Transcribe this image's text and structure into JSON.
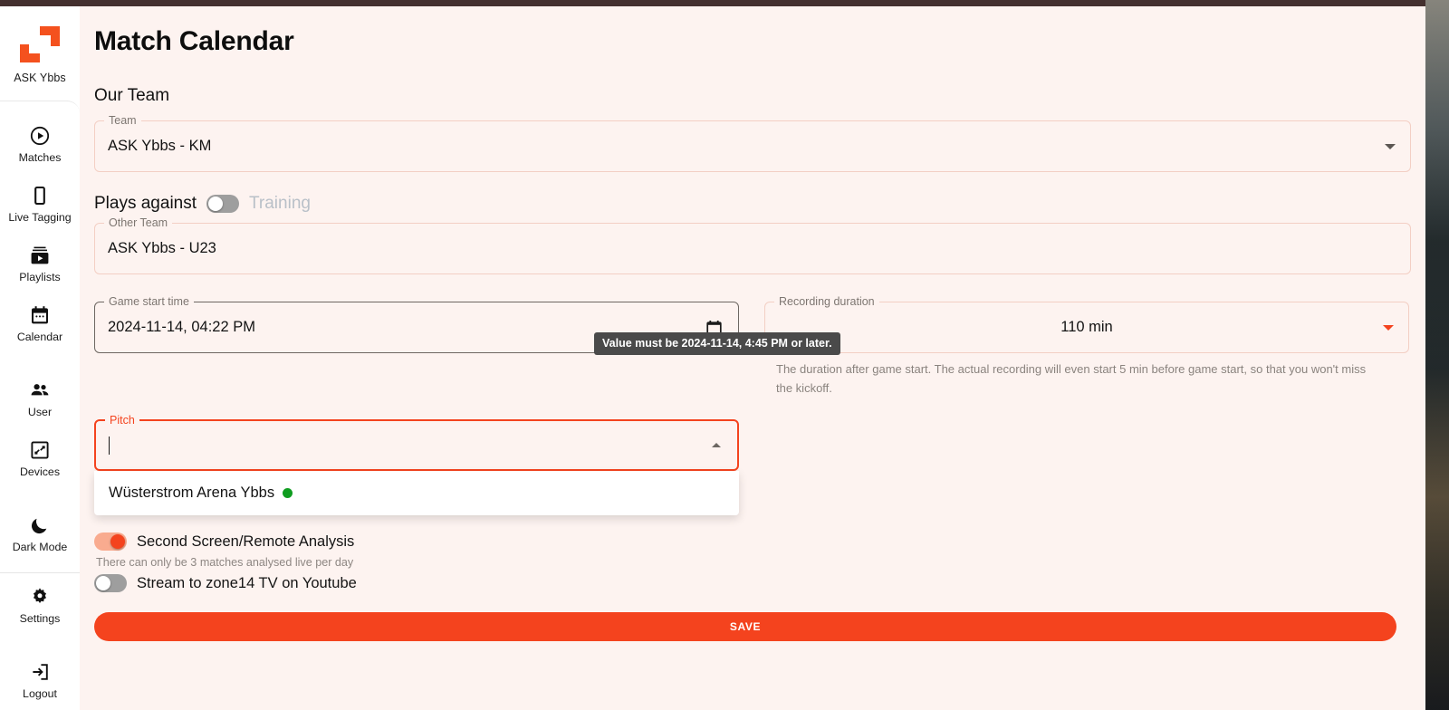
{
  "window": {
    "title_bar_color": "#44302f",
    "background_color": "#fdf3f0",
    "accent_color": "#f4431e"
  },
  "sidebar": {
    "brand_label": "ASK Ybbs",
    "items": [
      {
        "label": "Matches",
        "icon": "play-circle-icon"
      },
      {
        "label": "Live Tagging",
        "icon": "mobile-phone-icon"
      },
      {
        "label": "Playlists",
        "icon": "video-library-icon"
      },
      {
        "label": "Calendar",
        "icon": "calendar-icon"
      },
      {
        "label": "User",
        "icon": "people-icon"
      },
      {
        "label": "Devices",
        "icon": "device-screen-icon"
      },
      {
        "label": "Dark Mode",
        "icon": "moon-icon"
      },
      {
        "label": "Settings",
        "icon": "gear-icon"
      },
      {
        "label": "Logout",
        "icon": "logout-arrow-icon"
      }
    ]
  },
  "page": {
    "title": "Match Calendar",
    "our_team_heading": "Our Team"
  },
  "team_field": {
    "legend": "Team",
    "value": "ASK Ybbs - KM"
  },
  "plays_against": {
    "label": "Plays against",
    "toggle_state": "off",
    "training_label": "Training"
  },
  "other_team_field": {
    "legend": "Other Team",
    "value": "ASK Ybbs - U23"
  },
  "game_start_time": {
    "legend": "Game start time",
    "value": "2024-11-14, 04:22 PM",
    "icon": "calendar-picker-icon",
    "tooltip": "Value must be 2024-11-14, 4:45 PM or later."
  },
  "recording_duration": {
    "legend": "Recording duration",
    "value": "110 min",
    "helper": "The duration after game start. The actual recording will even start 5 min before game start, so that you won't miss the kickoff."
  },
  "pitch_field": {
    "legend": "Pitch",
    "value": "",
    "placeholder": "",
    "error": true,
    "options": [
      {
        "label": "Wüsterstrom Arena Ybbs",
        "status": "online",
        "status_color": "#0f9d20"
      }
    ]
  },
  "second_screen": {
    "label": "Second Screen/Remote Analysis",
    "toggle_state": "on",
    "note": "There can only be 3 matches analysed live per day"
  },
  "stream_youtube": {
    "label": "Stream to zone14 TV on Youtube",
    "toggle_state": "off"
  },
  "save_button": {
    "label": "SAVE"
  }
}
